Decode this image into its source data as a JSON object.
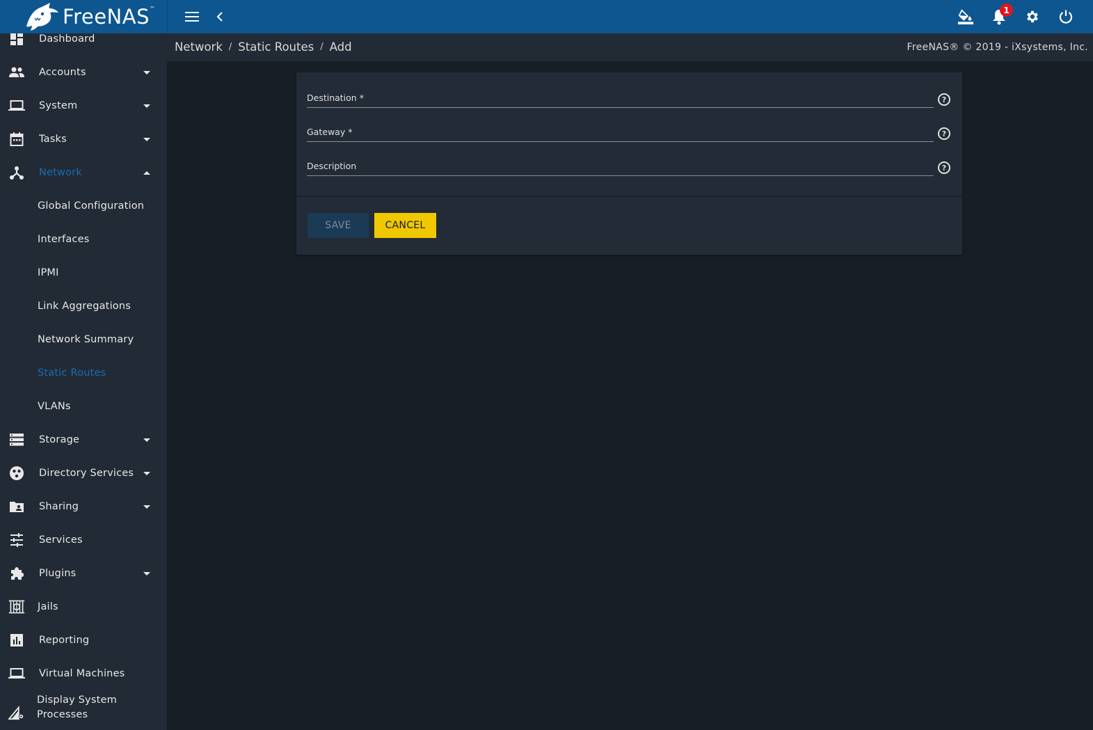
{
  "app": {
    "brand": "FreeNAS",
    "trademark": "™"
  },
  "topbar": {
    "notification_count": "1",
    "icons": [
      "menu-icon",
      "chevron-left-icon",
      "theme-bucket-icon",
      "bell-icon",
      "gear-icon",
      "power-icon"
    ]
  },
  "breadcrumb": {
    "items": [
      "Network",
      "Static Routes",
      "Add"
    ],
    "separator": "/"
  },
  "copyright": "FreeNAS® © 2019 - iXsystems, Inc.",
  "sidebar": {
    "items": [
      {
        "label": "Dashboard",
        "icon": "dashboard-icon"
      },
      {
        "label": "Accounts",
        "icon": "people-icon",
        "expandable": true
      },
      {
        "label": "System",
        "icon": "laptop-icon",
        "expandable": true
      },
      {
        "label": "Tasks",
        "icon": "calendar-icon",
        "expandable": true
      },
      {
        "label": "Network",
        "icon": "network-icon",
        "expandable": true,
        "expanded": true,
        "active": true
      },
      {
        "label": "Storage",
        "icon": "storage-icon",
        "expandable": true
      },
      {
        "label": "Directory Services",
        "icon": "directory-icon",
        "expandable": true
      },
      {
        "label": "Sharing",
        "icon": "shared-folder-icon",
        "expandable": true
      },
      {
        "label": "Services",
        "icon": "sliders-icon"
      },
      {
        "label": "Plugins",
        "icon": "puzzle-icon",
        "expandable": true
      },
      {
        "label": "Jails",
        "icon": "jail-icon"
      },
      {
        "label": "Reporting",
        "icon": "bar-chart-icon"
      },
      {
        "label": "Virtual Machines",
        "icon": "laptop-icon"
      },
      {
        "label": "Display System",
        "label2": "Processes",
        "icon": "process-icon"
      }
    ],
    "network_sub": [
      {
        "label": "Global Configuration"
      },
      {
        "label": "Interfaces"
      },
      {
        "label": "IPMI"
      },
      {
        "label": "Link Aggregations"
      },
      {
        "label": "Network Summary"
      },
      {
        "label": "Static Routes",
        "active": true
      },
      {
        "label": "VLANs"
      }
    ]
  },
  "form": {
    "fields": [
      {
        "label": "Destination *",
        "value": ""
      },
      {
        "label": "Gateway *",
        "value": ""
      },
      {
        "label": "Description",
        "value": ""
      }
    ],
    "help_glyph": "?",
    "save_label": "SAVE",
    "cancel_label": "CANCEL"
  },
  "colors": {
    "topbar": "#0d5690",
    "sidebar": "#222a35",
    "background": "#171e26",
    "active": "#1a6db3",
    "cancel": "#f0c800",
    "save_disabled": "#1a3a55",
    "badge": "#e0161e"
  }
}
